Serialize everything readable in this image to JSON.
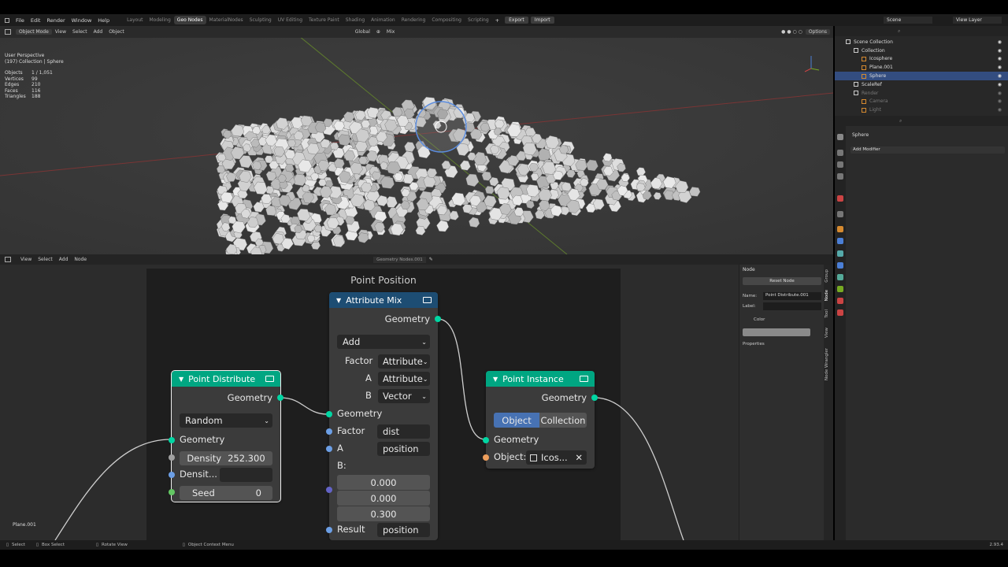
{
  "menu": {
    "items": [
      "File",
      "Edit",
      "Render",
      "Window",
      "Help"
    ]
  },
  "workspace_tabs": [
    "Layout",
    "Modeling",
    "Geo Nodes",
    "MaterialNodes",
    "Sculpting",
    "UV Editing",
    "Texture Paint",
    "Shading",
    "Animation",
    "Rendering",
    "Compositing",
    "Scripting"
  ],
  "active_workspace": "Geo Nodes",
  "top_buttons": {
    "export": "Export",
    "import": "Import"
  },
  "scene": {
    "name": "Scene",
    "view_layer": "View Layer"
  },
  "viewport": {
    "mode": "Object Mode",
    "menu": [
      "View",
      "Select",
      "Add",
      "Object"
    ],
    "transform": "Global",
    "blend": "Mix",
    "options": "Options",
    "perspective": "User Perspective",
    "collection": "(197) Collection | Sphere",
    "stats": [
      {
        "label": "Objects",
        "value": "1 / 1,051"
      },
      {
        "label": "Vertices",
        "value": "99"
      },
      {
        "label": "Edges",
        "value": "210"
      },
      {
        "label": "Faces",
        "value": "116"
      },
      {
        "label": "Triangles",
        "value": "188"
      }
    ]
  },
  "outliner": {
    "items": [
      {
        "label": "Scene Collection",
        "indent": 0,
        "selected": false,
        "dim": false
      },
      {
        "label": "Collection",
        "indent": 1,
        "selected": false,
        "dim": false
      },
      {
        "label": "Icosphere",
        "indent": 2,
        "selected": false,
        "dim": false
      },
      {
        "label": "Plane.001",
        "indent": 2,
        "selected": false,
        "dim": false
      },
      {
        "label": "Sphere",
        "indent": 2,
        "selected": true,
        "dim": false
      },
      {
        "label": "ScaleRef",
        "indent": 1,
        "selected": false,
        "dim": false
      },
      {
        "label": "Render",
        "indent": 1,
        "selected": false,
        "dim": true
      },
      {
        "label": "Camera",
        "indent": 2,
        "selected": false,
        "dim": true
      },
      {
        "label": "Light",
        "indent": 2,
        "selected": false,
        "dim": true
      }
    ]
  },
  "properties": {
    "object": "Sphere",
    "add_modifier": "Add Modifier"
  },
  "node_editor": {
    "menu": [
      "View",
      "Select",
      "Add",
      "Node"
    ],
    "tree_name": "Geometry Nodes.001",
    "frame_label": "Point Position",
    "corner_label": "Plane.001"
  },
  "nodes": {
    "point_distribute": {
      "title": "Point Distribute",
      "out_geometry": "Geometry",
      "mode": "Random",
      "in_geometry": "Geometry",
      "density_label": "Density",
      "density_value": "252.300",
      "density_attr_label": "Densit...",
      "seed_label": "Seed",
      "seed_value": "0"
    },
    "attribute_mix": {
      "title": "Attribute Mix",
      "out_geometry": "Geometry",
      "blend": "Add",
      "factor_label": "Factor",
      "factor_type": "Attribute",
      "a_label": "A",
      "a_type": "Attribute",
      "b_label": "B",
      "b_type": "Vector",
      "in_geometry": "Geometry",
      "factor_in_label": "Factor",
      "factor_in_value": "dist",
      "a_in_label": "A",
      "a_in_value": "position",
      "b_in_label": "B:",
      "b_x": "0.000",
      "b_y": "0.000",
      "b_z": "0.300",
      "result_label": "Result",
      "result_value": "position"
    },
    "point_instance": {
      "title": "Point Instance",
      "out_geometry": "Geometry",
      "opt_object": "Object",
      "opt_collection": "Collection",
      "in_geometry": "Geometry",
      "object_label": "Object:",
      "object_value": "Icos..."
    }
  },
  "npanel": {
    "header": "Node",
    "reset": "Reset Node",
    "name_label": "Name:",
    "name_value": "Point Distribute.001",
    "label_label": "Label:",
    "color_label": "Color",
    "properties_label": "Properties",
    "tabs": [
      "Group",
      "Node",
      "Tool",
      "View",
      "Node Wrangler"
    ]
  },
  "statusbar": {
    "select": "Select",
    "box_select": "Box Select",
    "rotate": "Rotate View",
    "context": "Object Context Menu",
    "version": "2.93.4"
  },
  "colors": {
    "geo_node_header": "#00a682",
    "attr_node_header": "#1d4d73",
    "selected_blue": "#4772b3",
    "link": "#cfcfcf"
  }
}
